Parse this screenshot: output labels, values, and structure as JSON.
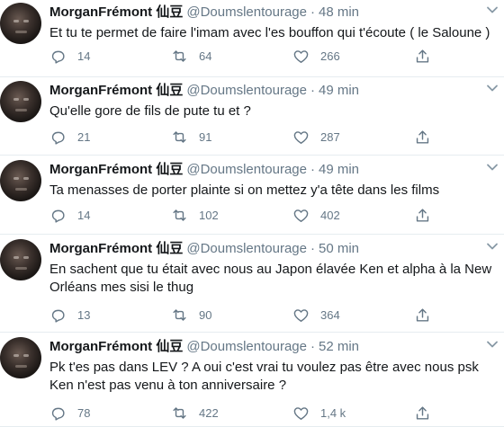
{
  "tweets": [
    {
      "name": "MorganFrémont 仙豆",
      "handle": "@Doumslentourage",
      "separator": "·",
      "time": "48 min",
      "lines": [
        "Et tu te permet de faire l'imam avec l'es bouffon qui t'écoute ( le Saloune )"
      ],
      "replies": "14",
      "retweets": "64",
      "likes": "266"
    },
    {
      "name": "MorganFrémont 仙豆",
      "handle": "@Doumslentourage",
      "separator": "·",
      "time": "49 min",
      "lines": [
        "Qu'elle gore de fils de pute tu et ?"
      ],
      "replies": "21",
      "retweets": "91",
      "likes": "287"
    },
    {
      "name": "MorganFrémont 仙豆",
      "handle": "@Doumslentourage",
      "separator": "·",
      "time": "49 min",
      "lines": [
        "Ta menasses de porter plainte si on mettez y'a tête dans les films"
      ],
      "replies": "14",
      "retweets": "102",
      "likes": "402"
    },
    {
      "name": "MorganFrémont 仙豆",
      "handle": "@Doumslentourage",
      "separator": "·",
      "time": "50 min",
      "lines": [
        "En sachent que tu était avec nous au Japon élavée Ken et alpha à la New",
        "Orléans mes sisi le thug"
      ],
      "replies": "13",
      "retweets": "90",
      "likes": "364"
    },
    {
      "name": "MorganFrémont 仙豆",
      "handle": "@Doumslentourage",
      "separator": "·",
      "time": "52 min",
      "lines": [
        "Pk t'es pas dans LEV ? A oui c'est vrai tu voulez pas être avec nous psk",
        "Ken n'est pas venu à ton anniversaire ?"
      ],
      "replies": "78",
      "retweets": "422",
      "likes": "1,4 k"
    }
  ],
  "icons": {
    "reply": "reply-icon",
    "retweet": "retweet-icon",
    "like": "heart-icon",
    "share": "share-icon",
    "caret": "chevron-down-icon"
  },
  "colors": {
    "text": "#14171a",
    "secondary": "#657786",
    "divider": "#e6ecf0"
  }
}
